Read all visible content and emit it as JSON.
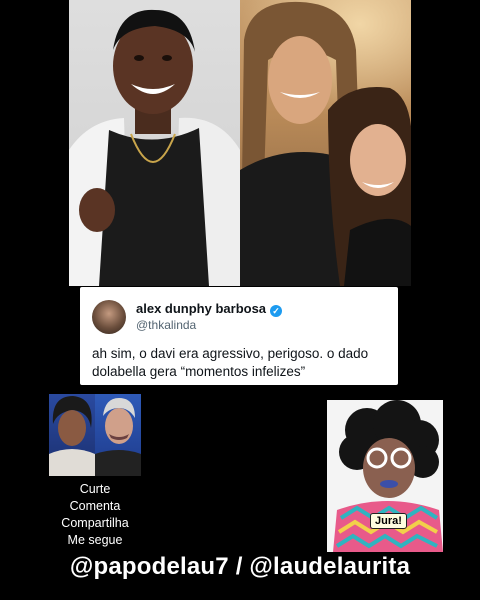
{
  "tweet": {
    "name": "alex dunphy barbosa",
    "handle": "@thkalinda",
    "verified_icon": "verified-badge",
    "text": "ah sim, o davi era agressivo, perigoso. o dado dolabella gera “momentos infelizes”"
  },
  "promo": {
    "line1": "Curte",
    "line2": "Comenta",
    "line3": "Compartilha",
    "line4": "Me segue"
  },
  "sticker": {
    "label": "Jura!"
  },
  "footer": {
    "handles": "@papodelau7 / @laudelaurita"
  },
  "colors": {
    "background": "#000000",
    "verified": "#1d9bf0",
    "footer_text": "#ffffff"
  }
}
